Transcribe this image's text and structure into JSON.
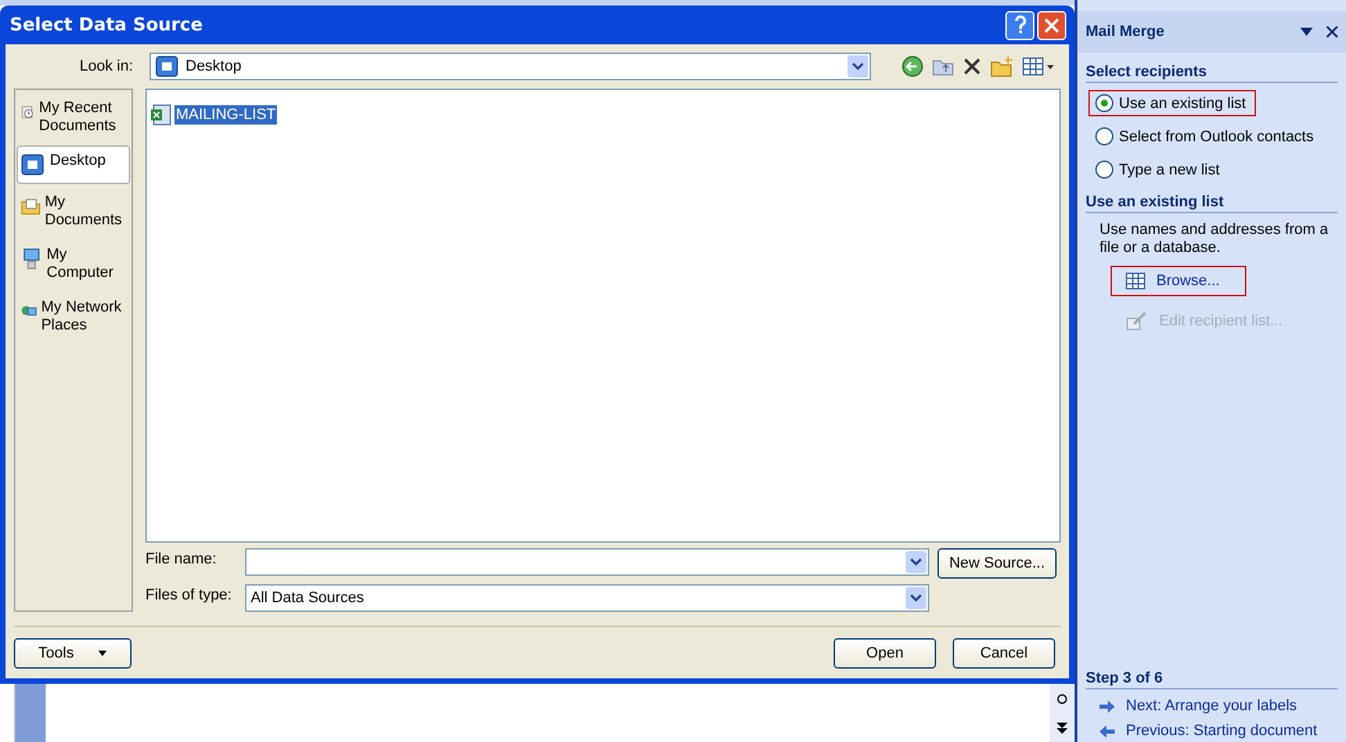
{
  "dialog": {
    "title": "Select Data Source",
    "look_in": {
      "label": "Look in:",
      "value": "Desktop"
    },
    "places": [
      {
        "kind": "recent",
        "label": "My Recent Documents",
        "selected": false
      },
      {
        "kind": "desktop",
        "label": "Desktop",
        "selected": true
      },
      {
        "kind": "documents",
        "label": "My Documents",
        "selected": false
      },
      {
        "kind": "computer",
        "label": "My Computer",
        "selected": false
      },
      {
        "kind": "network",
        "label": "My Network Places",
        "selected": false
      }
    ],
    "files": [
      {
        "name": "MAILING-LIST",
        "selected": true
      }
    ],
    "file_name": {
      "label": "File name:"
    },
    "files_of_type": {
      "label": "Files of type:",
      "value": "All Data Sources"
    },
    "new_source": "New Source...",
    "tools": "Tools",
    "open": "Open",
    "cancel": "Cancel"
  },
  "task_pane": {
    "title": "Mail Merge",
    "select_heading": "Select recipients",
    "options": [
      {
        "label": "Use an existing list",
        "selected": true,
        "highlighted": true
      },
      {
        "label": "Select from Outlook contacts",
        "selected": false,
        "highlighted": false
      },
      {
        "label": "Type a new list",
        "selected": false,
        "highlighted": false
      }
    ],
    "existing_heading": "Use an existing list",
    "description": "Use names and addresses from a file or a database.",
    "actions": [
      {
        "label": "Browse...",
        "disabled": false,
        "highlighted": true
      },
      {
        "label": "Edit recipient list...",
        "disabled": true,
        "highlighted": false
      }
    ],
    "step": "Step 3 of 6",
    "next": "Next: Arrange your labels",
    "previous": "Previous: Starting document"
  }
}
